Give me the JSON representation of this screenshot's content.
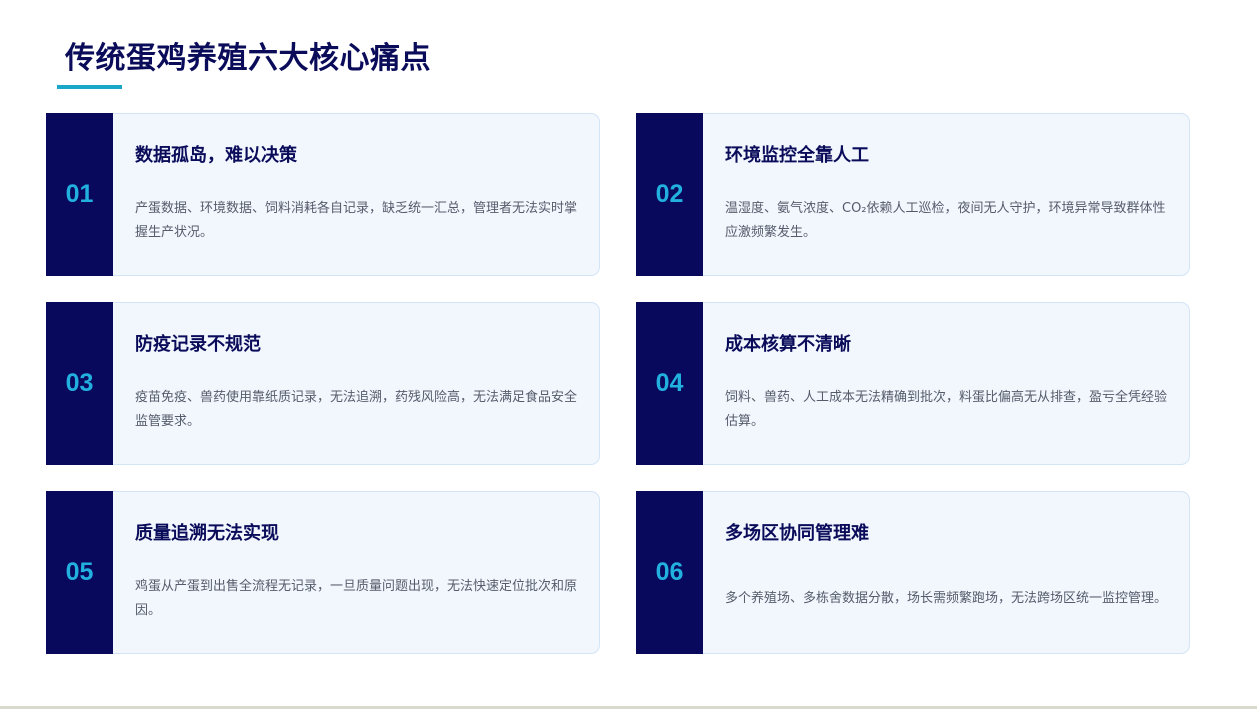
{
  "title": "传统蛋鸡养殖六大核心痛点",
  "cards": [
    {
      "num": "01",
      "title": "数据孤岛，难以决策",
      "desc": "产蛋数据、环境数据、饲料消耗各自记录，缺乏统一汇总，管理者无法实时掌握生产状况。"
    },
    {
      "num": "02",
      "title": "环境监控全靠人工",
      "desc": "温湿度、氨气浓度、CO₂依赖人工巡检，夜间无人守护，环境异常导致群体性应激频繁发生。"
    },
    {
      "num": "03",
      "title": "防疫记录不规范",
      "desc": "疫苗免疫、兽药使用靠纸质记录，无法追溯，药残风险高，无法满足食品安全监管要求。"
    },
    {
      "num": "04",
      "title": "成本核算不清晰",
      "desc": "饲料、兽药、人工成本无法精确到批次，料蛋比偏高无从排查，盈亏全凭经验估算。"
    },
    {
      "num": "05",
      "title": "质量追溯无法实现",
      "desc": "鸡蛋从产蛋到出售全流程无记录，一旦质量问题出现，无法快速定位批次和原因。"
    },
    {
      "num": "06",
      "title": "多场区协同管理难",
      "desc": "多个养殖场、多栋舍数据分散，场长需频繁跑场，无法跨场区统一监控管理。"
    }
  ]
}
